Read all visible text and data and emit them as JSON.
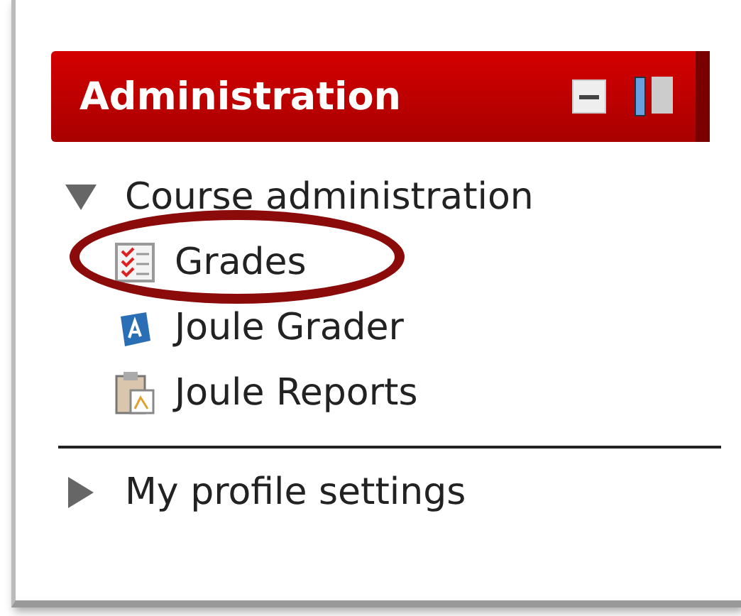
{
  "block": {
    "title": "Administration"
  },
  "tree": [
    {
      "label": "Course administration",
      "expanded": true,
      "children": [
        {
          "label": "Grades",
          "kind": "grades",
          "highlighted": true
        },
        {
          "label": "Joule Grader",
          "kind": "grader",
          "highlighted": false
        },
        {
          "label": "Joule Reports",
          "kind": "reports",
          "highlighted": false
        }
      ]
    },
    {
      "label": "My profile settings",
      "expanded": false
    }
  ]
}
